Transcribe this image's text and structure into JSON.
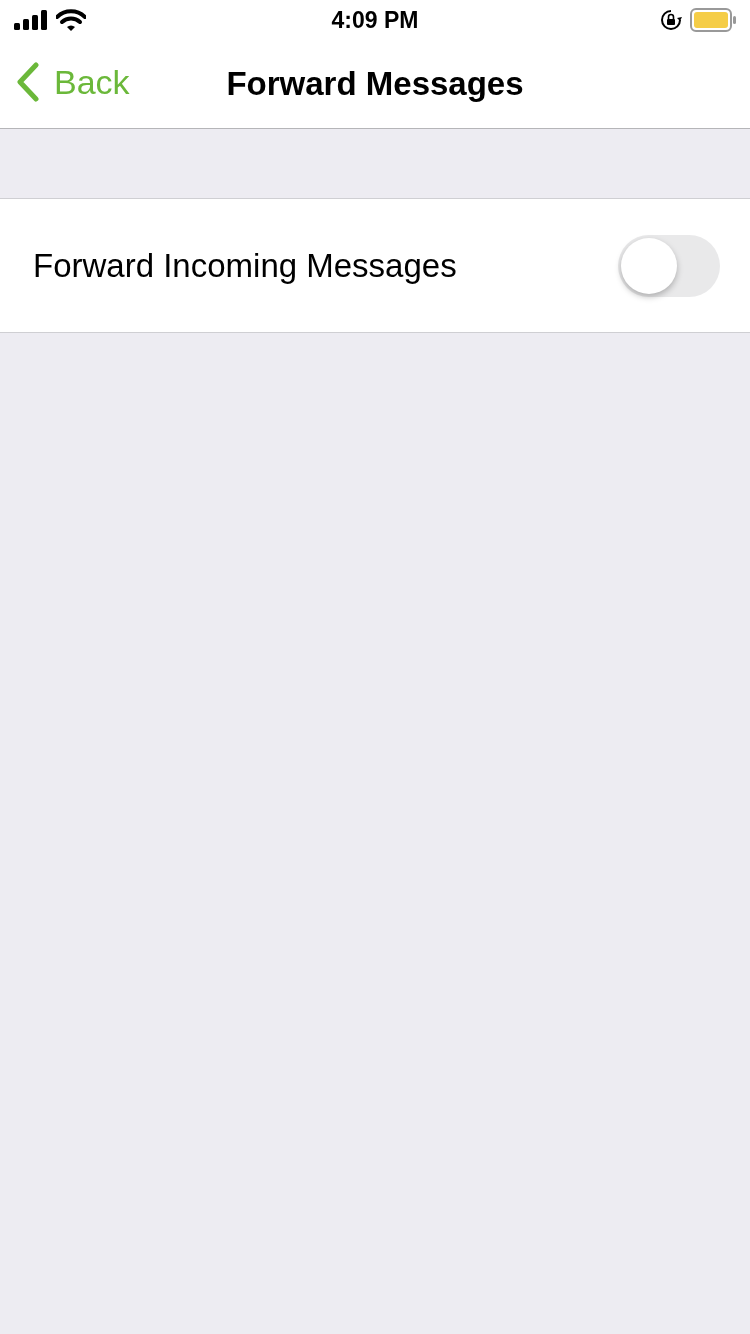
{
  "status_bar": {
    "time": "4:09 PM"
  },
  "nav_bar": {
    "back": "Back",
    "title": "Forward Messages"
  },
  "settings": [
    {
      "kind": "toggle",
      "label": "Forward Incoming Messages",
      "on": false
    }
  ]
}
